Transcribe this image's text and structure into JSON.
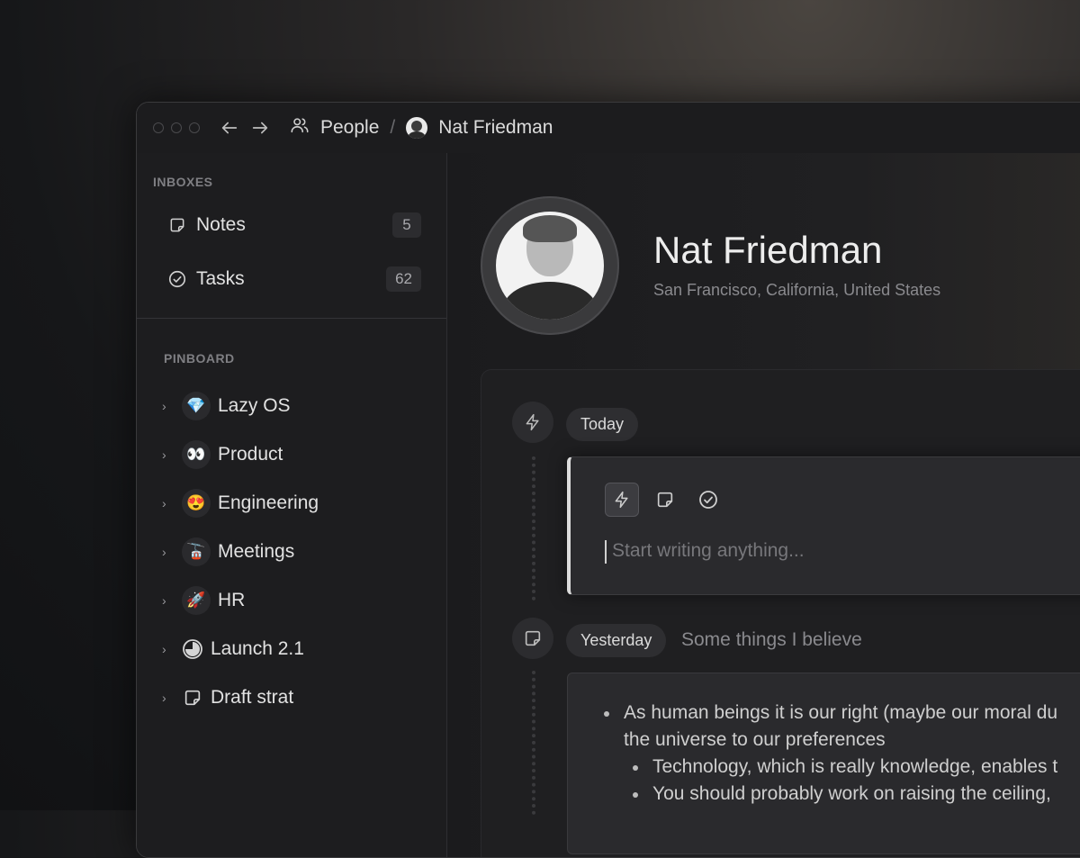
{
  "breadcrumb": {
    "section": "People",
    "separator": "/",
    "current": "Nat Friedman"
  },
  "sidebar": {
    "inboxes_label": "INBOXES",
    "inboxes": [
      {
        "label": "Notes",
        "count": "5",
        "icon": "note-icon"
      },
      {
        "label": "Tasks",
        "count": "62",
        "icon": "check-circle-icon"
      }
    ],
    "pinboard_label": "PINBOARD",
    "pinboard": [
      {
        "label": "Lazy OS",
        "emoji": "💎"
      },
      {
        "label": "Product",
        "emoji": "👀"
      },
      {
        "label": "Engineering",
        "emoji": "😍"
      },
      {
        "label": "Meetings",
        "emoji": "🚡"
      },
      {
        "label": "HR",
        "emoji": "🚀"
      },
      {
        "label": "Launch 2.1",
        "icon": "progress-pie-icon"
      },
      {
        "label": "Draft strat",
        "icon": "note-icon"
      }
    ]
  },
  "profile": {
    "name": "Nat Friedman",
    "location": "San Francisco, California, United States"
  },
  "feed": {
    "today_label": "Today",
    "composer_placeholder": "Start writing anything...",
    "yesterday_label": "Yesterday",
    "yesterday_title": "Some things I believe",
    "note_lines": [
      "As human beings it is our right (maybe our moral du",
      "the universe to our preferences",
      "Technology, which is really knowledge, enables t",
      "You should probably work on raising the ceiling,"
    ]
  }
}
